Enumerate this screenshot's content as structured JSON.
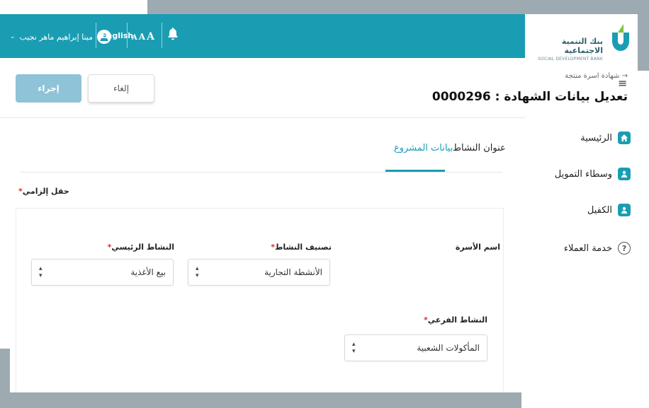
{
  "header": {
    "user_name": "مينا إبراهيم ماهر نجيب",
    "language": "English",
    "font_size_label": [
      "A",
      "A",
      "A"
    ],
    "accent_color": "#1a9db3"
  },
  "logo": {
    "arabic": "بنك التنمية الاجتماعية",
    "english": "SOCIAL DEVELOPMENT BANK"
  },
  "sidebar": {
    "items": [
      {
        "label": "الرئيسية",
        "icon": "home-icon"
      },
      {
        "label": "وسطاء التمويل",
        "icon": "person-icon"
      },
      {
        "label": "الكفيل",
        "icon": "person-icon"
      },
      {
        "label": "خدمة العملاء",
        "icon": "question-icon"
      }
    ]
  },
  "page": {
    "breadcrumb": "شهادة اسرة منتجة",
    "title": "تعديل بيانات الشهادة : 0000296",
    "cancel_label": "إلغاء",
    "submit_label": "إجراء"
  },
  "tabs": [
    {
      "label": "عنوان النشاط",
      "active": false
    },
    {
      "label": "بيانات المشروع",
      "active": true
    }
  ],
  "form": {
    "required_note": "حقل إلزامي",
    "family_name_label": "اسم الأسرة",
    "activity_class": {
      "label": "تصنيف النشاط",
      "value": "الأنشطة التجارية"
    },
    "main_activity": {
      "label": "النشاط الرئيسي",
      "value": "بيع الأغذية"
    },
    "sub_activity": {
      "label": "النشاط الفرعي",
      "value": "المأكولات الشعبية"
    }
  }
}
